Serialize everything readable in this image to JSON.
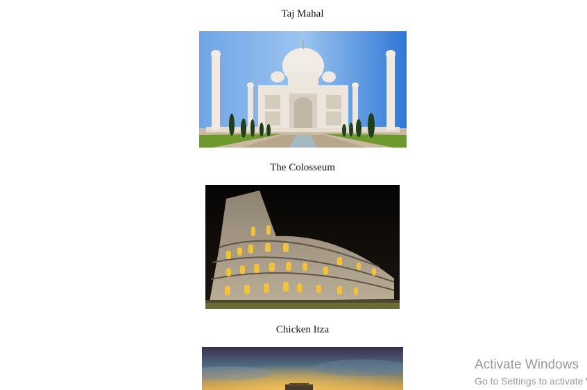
{
  "gallery": {
    "items": [
      {
        "title": "Taj Mahal",
        "image": "taj-mahal-photo"
      },
      {
        "title": "The Colosseum",
        "image": "colosseum-photo"
      },
      {
        "title": "Chicken Itza",
        "image": "chichen-itza-photo"
      }
    ]
  },
  "watermark": {
    "title": "Activate Windows",
    "subtitle": "Go to Settings to activate Windows."
  }
}
